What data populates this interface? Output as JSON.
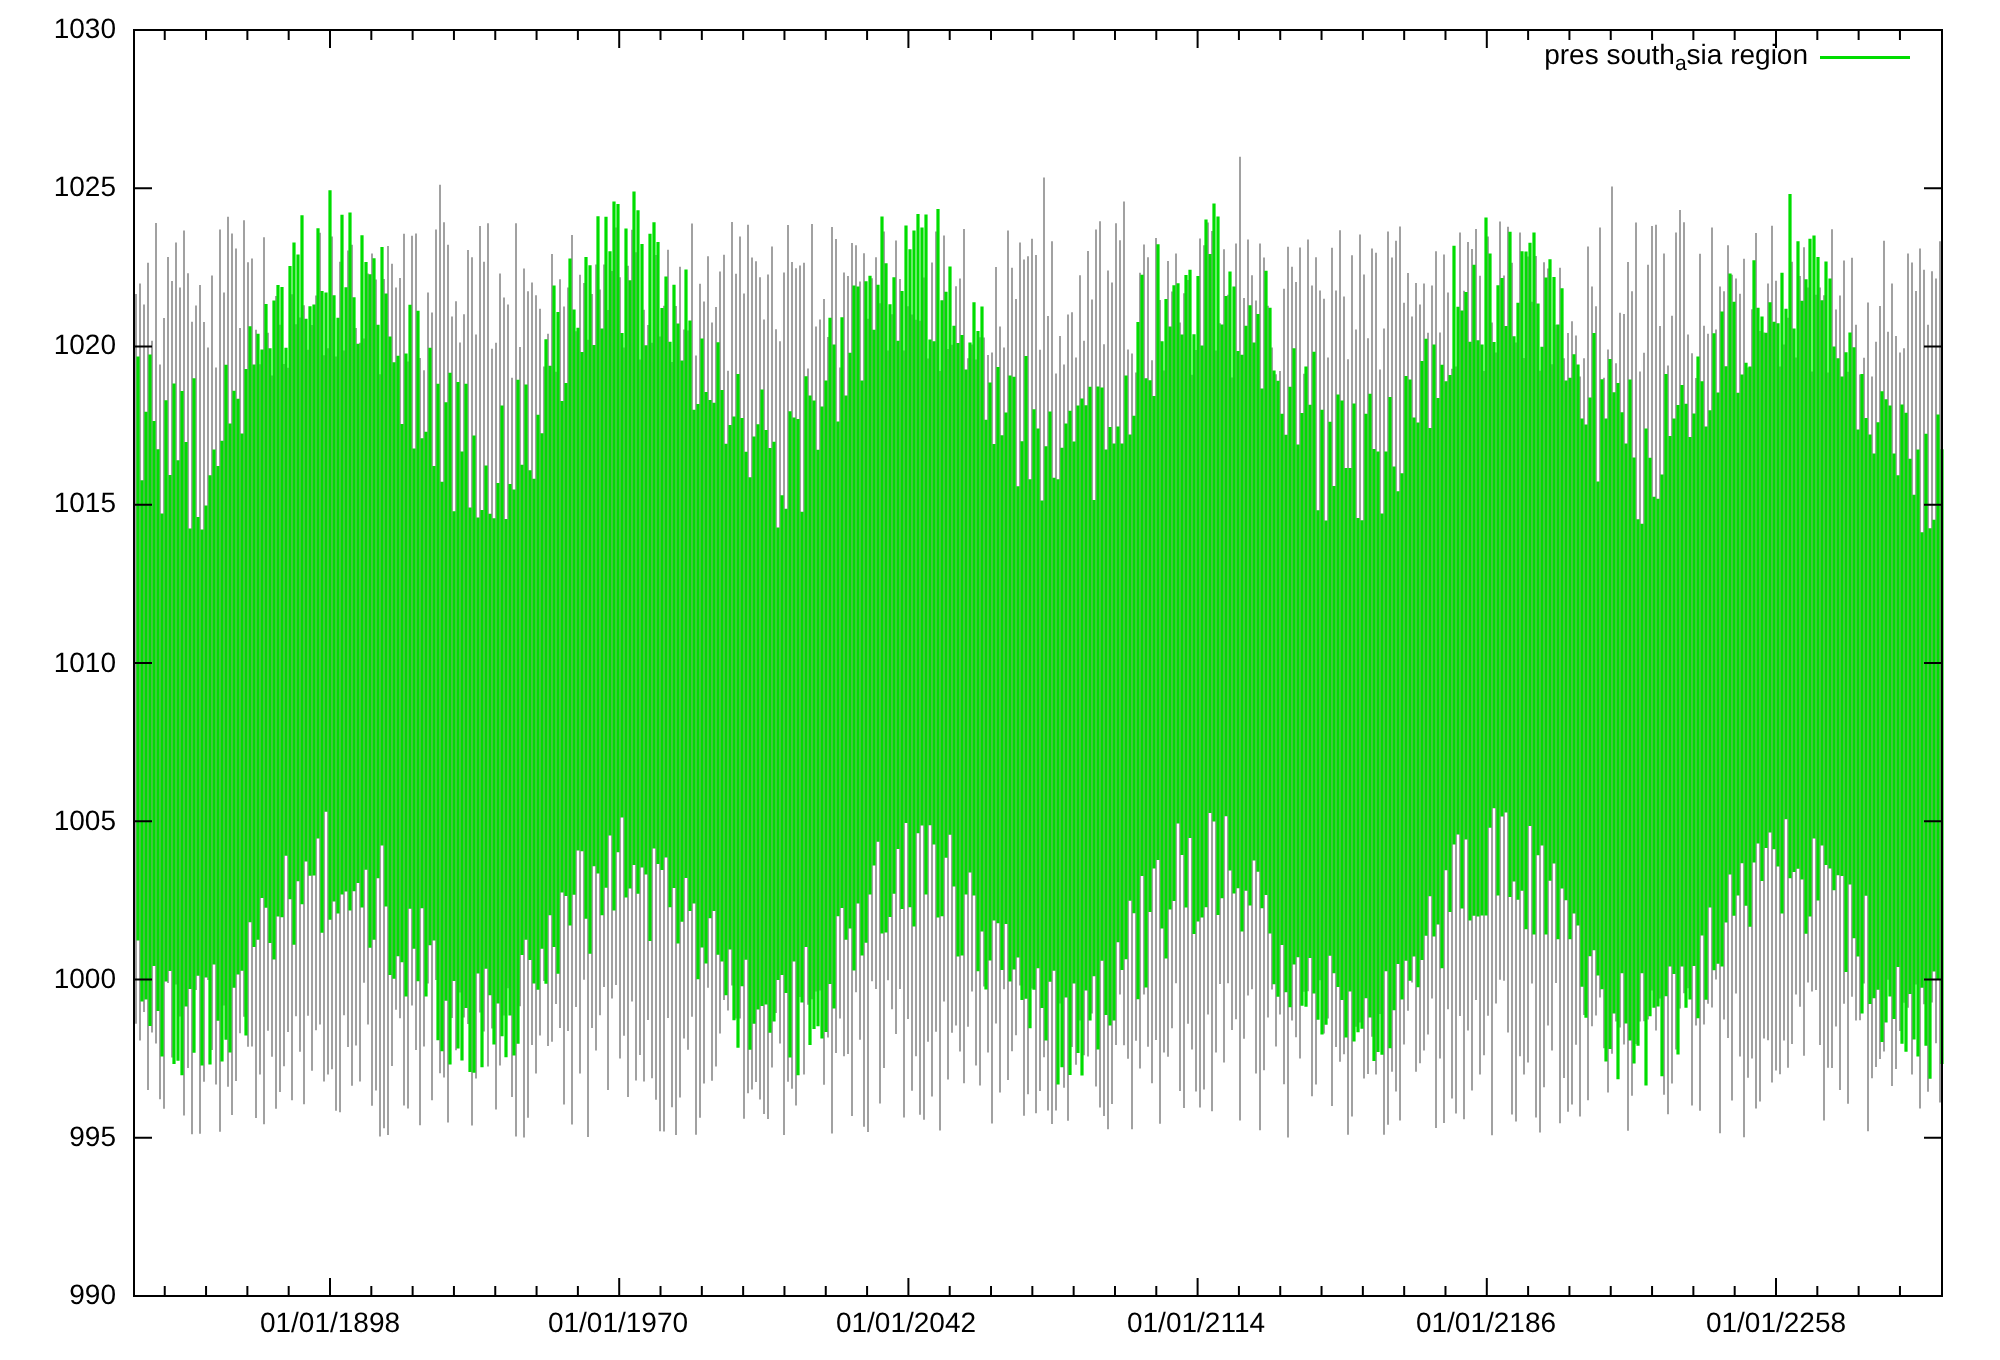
{
  "plot": {
    "legend": {
      "label": "pres south$_{a}$sia region",
      "color": "#00dd00"
    },
    "y_tick_labels": [
      "1030",
      "1025",
      "1020",
      "1015",
      "1010",
      "1005",
      "1000",
      "995",
      "990"
    ],
    "x_tick_labels": [
      "01/01/1898",
      "01/01/1970",
      "01/01/2042",
      "01/01/2114",
      "01/01/2186",
      "01/01/2258"
    ]
  }
}
